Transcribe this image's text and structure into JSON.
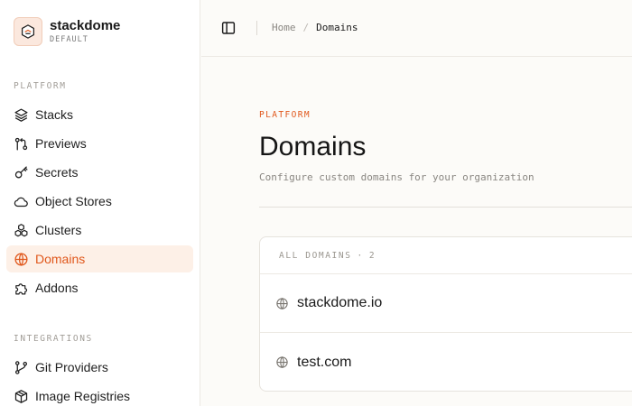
{
  "brand": {
    "name": "stackdome",
    "workspace": "DEFAULT"
  },
  "sidebar": {
    "platform_label": "PLATFORM",
    "integrations_label": "INTEGRATIONS",
    "items": [
      {
        "label": "Stacks",
        "icon": "layers-icon"
      },
      {
        "label": "Previews",
        "icon": "git-pull-request-icon"
      },
      {
        "label": "Secrets",
        "icon": "key-icon"
      },
      {
        "label": "Object Stores",
        "icon": "cloud-icon"
      },
      {
        "label": "Clusters",
        "icon": "boxes-icon"
      },
      {
        "label": "Domains",
        "icon": "globe-icon",
        "active": true
      },
      {
        "label": "Addons",
        "icon": "puzzle-icon"
      }
    ],
    "integrations": [
      {
        "label": "Git Providers",
        "icon": "git-branch-icon"
      },
      {
        "label": "Image Registries",
        "icon": "package-icon"
      }
    ]
  },
  "header": {
    "breadcrumb": [
      "Home",
      "/",
      "Domains"
    ]
  },
  "main": {
    "eyebrow": "PLATFORM",
    "title": "Domains",
    "description": "Configure custom domains for your organization",
    "list": {
      "header_label": "ALL DOMAINS",
      "separator": "·",
      "count": "2",
      "domains": [
        "stackdome.io",
        "test.com"
      ]
    }
  },
  "colors": {
    "accent": "#e0571b",
    "active_bg": "#fdf0e7",
    "page_bg": "#fcfbf8"
  }
}
